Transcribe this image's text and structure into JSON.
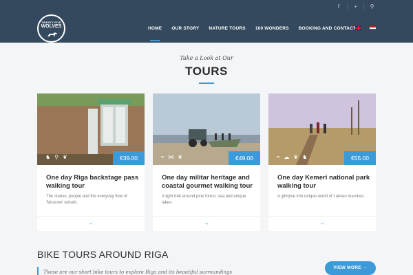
{
  "header": {
    "logo": {
      "line1": "TWENTY FIVE",
      "line2": "WOLVES"
    },
    "top_icons": [
      "facebook-icon",
      "cart-icon",
      "search-icon"
    ],
    "nav": [
      {
        "label": "HOME",
        "active": true
      },
      {
        "label": "OUR STORY"
      },
      {
        "label": "NATURE TOURS"
      },
      {
        "label": "100 WONDERS"
      },
      {
        "label": "BOOKING AND CONTACT"
      }
    ],
    "languages": [
      "en-flag",
      "lv-flag"
    ]
  },
  "tours_section": {
    "tagline": "Take a Look at Our",
    "title": "TOURS"
  },
  "cards": [
    {
      "price": "€39.00",
      "title": "One day Riga backstage pass walking tour",
      "description": "The stories, people and the everyday  flow of 'Moscow' suburb.",
      "icons": [
        "walker-icon",
        "bike-icon",
        "leaf-icon"
      ]
    },
    {
      "price": "€49.00",
      "title": "One day militar heritage and coastal gourmet walking tour",
      "description": "A light trek around pine forest, sea and unique lakes.",
      "icons": [
        "waves-icon",
        "fish-icon",
        "leaf-icon"
      ]
    },
    {
      "price": "€55.00",
      "title": "One day Kemeri national park walking tour",
      "description": "A glimpse into unique world of Latvian marshes.",
      "icons": [
        "water-icon",
        "cloud-icon",
        "leaf-icon",
        "boar-icon"
      ]
    }
  ],
  "bike_section": {
    "title": "BIKE TOURS AROUND RIGA",
    "subtitle": "These are our short bike tours to explore Riga and its beautiful surroundings",
    "button": "VIEW MORE →"
  }
}
